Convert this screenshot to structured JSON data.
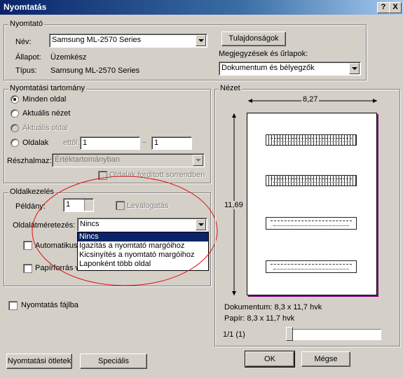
{
  "window": {
    "title": "Nyomtatás",
    "help_btn": "?",
    "close_btn": "X"
  },
  "printer": {
    "group_label": "Nyomtató",
    "name_label": "Név:",
    "name_value": "Samsung ML-2570 Series",
    "status_label": "Állapot:",
    "status_value": "Üzemkész",
    "type_label": "Típus:",
    "type_value": "Samsung ML-2570 Series",
    "properties_btn": "Tulajdonságok",
    "comments_label": "Megjegyzések és űrlapok:",
    "comments_value": "Dokumentum és bélyegzők"
  },
  "range": {
    "group_label": "Nyomtatási tartomány",
    "all_pages": "Minden oldal",
    "current_view": "Aktuális nézet",
    "current_page": "Aktuális oldal",
    "pages": "Oldalak",
    "from_label": "ettől:",
    "from_value": "1",
    "dash": "–",
    "to_value": "1",
    "subset_label": "Részhalmaz:",
    "subset_value": "Értéktartományban",
    "reverse": "Oldalak fordított sorrendben"
  },
  "handling": {
    "group_label": "Oldalkezelés",
    "copies_label": "Példány:",
    "copies_value": "1",
    "collate": "Leválogatás",
    "scaling_label": "Oldalátméretezés:",
    "scaling_value": "Nincs",
    "scaling_options": [
      "Nincs",
      "Igazítás a nyomtató margóihoz",
      "Kicsinyítés a nyomtató margóihoz",
      "Laponként több oldal"
    ],
    "auto_rotate": "Automatikus",
    "paper_source": "Papírforrás választása a PDF oldalméret szerint"
  },
  "print_to_file": "Nyomtatás fájlba",
  "preview": {
    "group_label": "Nézet",
    "width": "8,27",
    "height": "11,69",
    "document": "Dokumentum: 8,3 x 11,7 hvk",
    "paper": "Papír: 8,3 x 11,7 hvk",
    "page_indicator": "1/1 (1)"
  },
  "buttons": {
    "tips": "Nyomtatási ötletek",
    "special": "Speciális",
    "ok": "OK",
    "cancel": "Mégse"
  }
}
